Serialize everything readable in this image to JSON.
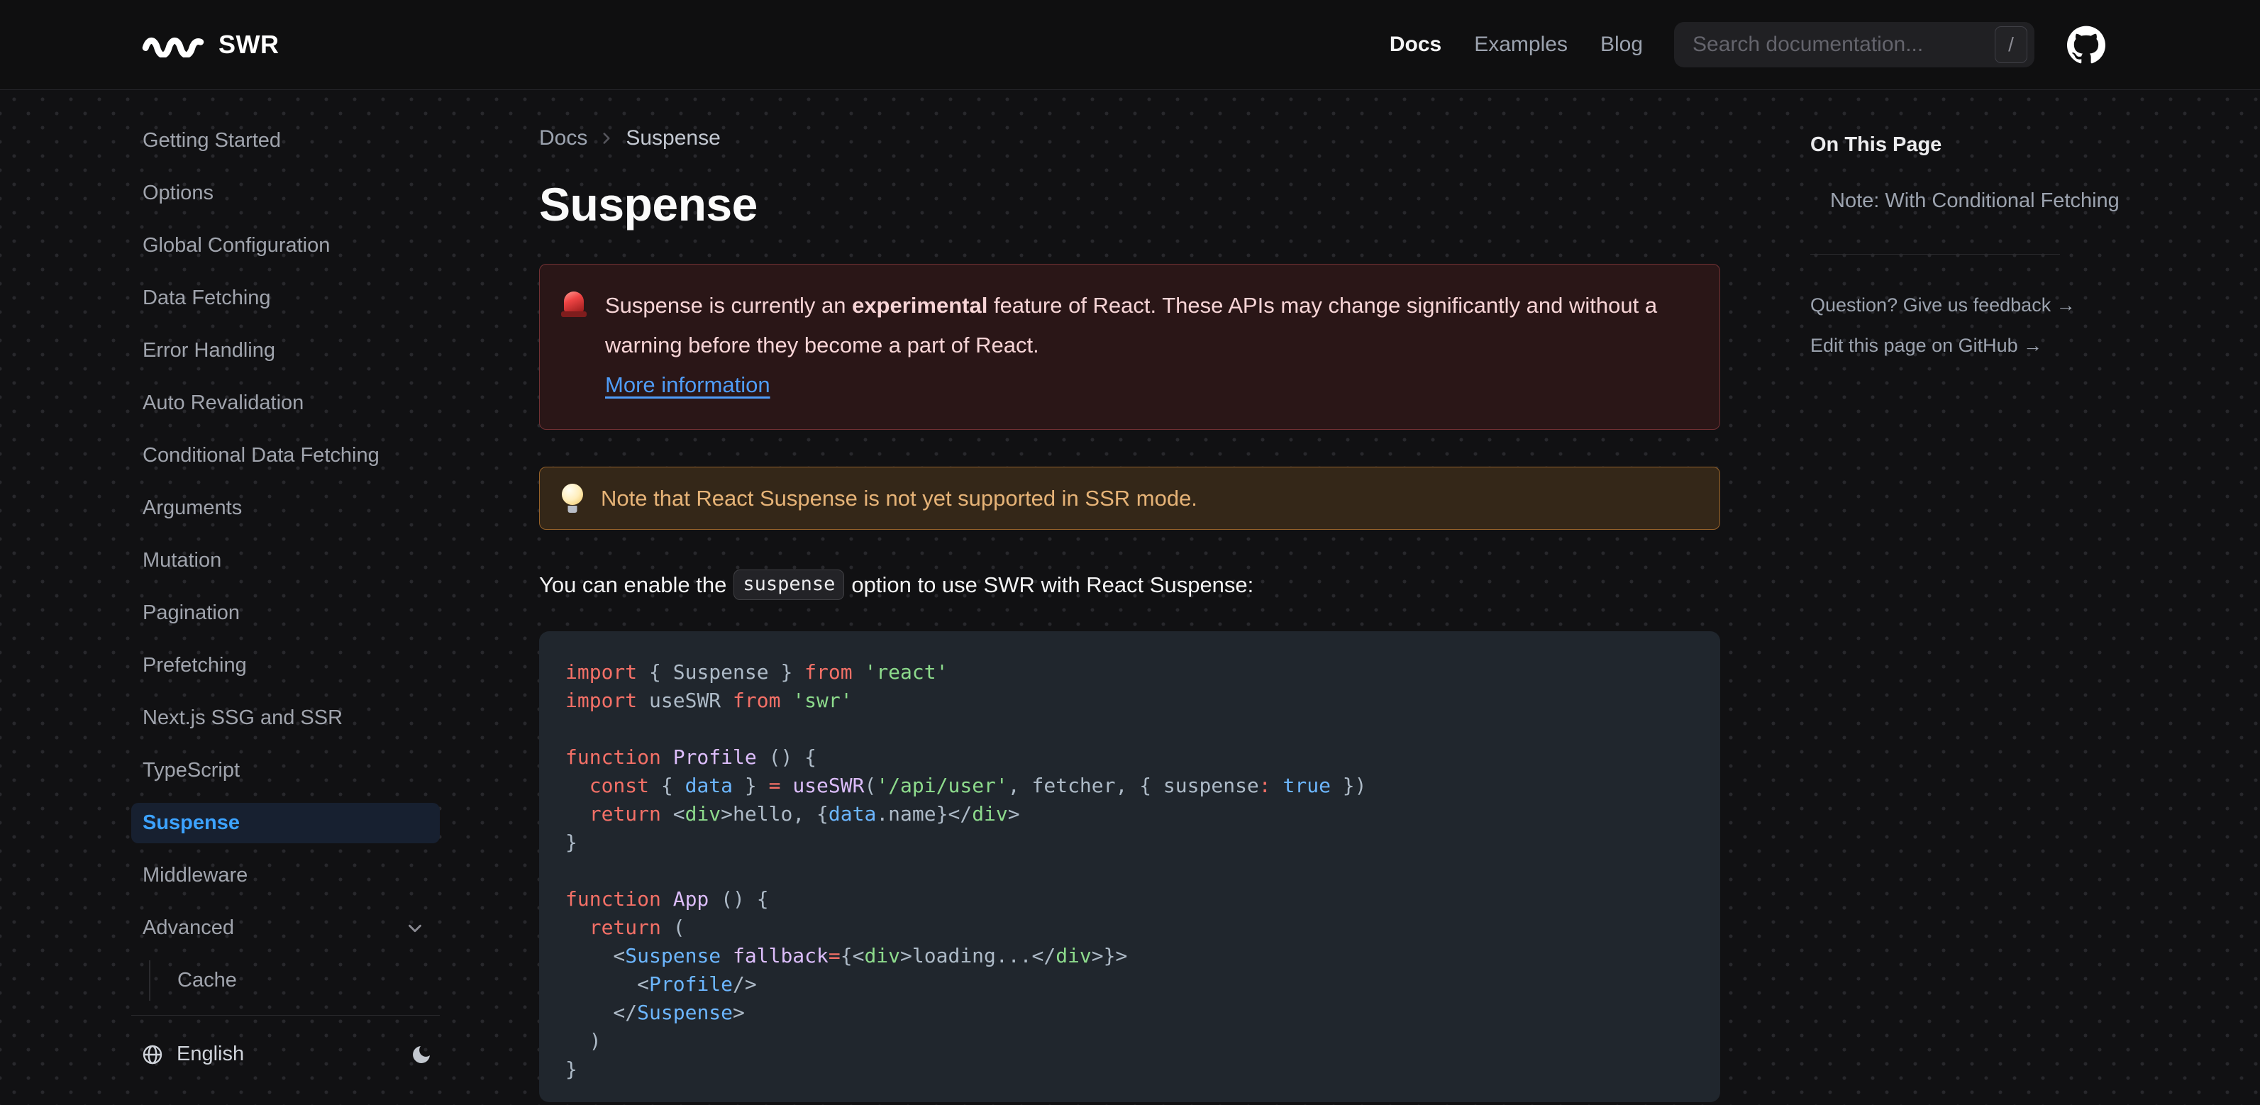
{
  "header": {
    "brand": "SWR",
    "nav": [
      {
        "label": "Docs",
        "active": true
      },
      {
        "label": "Examples",
        "active": false
      },
      {
        "label": "Blog",
        "active": false
      }
    ],
    "search": {
      "placeholder": "Search documentation...",
      "shortcut": "/"
    },
    "icons": {
      "logo": "swr-wave-icon",
      "github": "github-icon"
    }
  },
  "sidebar": {
    "items": [
      {
        "label": "Getting Started"
      },
      {
        "label": "Options"
      },
      {
        "label": "Global Configuration"
      },
      {
        "label": "Data Fetching"
      },
      {
        "label": "Error Handling"
      },
      {
        "label": "Auto Revalidation"
      },
      {
        "label": "Conditional Data Fetching"
      },
      {
        "label": "Arguments"
      },
      {
        "label": "Mutation"
      },
      {
        "label": "Pagination"
      },
      {
        "label": "Prefetching"
      },
      {
        "label": "Next.js SSG and SSR"
      },
      {
        "label": "TypeScript"
      },
      {
        "label": "Suspense",
        "active": true
      },
      {
        "label": "Middleware"
      },
      {
        "label": "Advanced",
        "expandable": true
      }
    ],
    "sub_items": [
      {
        "label": "Cache",
        "parent": "Advanced"
      }
    ],
    "language": "English",
    "icons": {
      "language": "globe-icon",
      "theme_toggle": "moon-icon",
      "advanced": "chevron-down-icon"
    }
  },
  "breadcrumb": {
    "items": [
      "Docs",
      "Suspense"
    ],
    "separator_icon": "chevron-right-icon"
  },
  "page": {
    "title": "Suspense",
    "warning_callout": {
      "icon": "police-light-icon",
      "text_before_bold": "Suspense is currently an ",
      "bold_text": "experimental",
      "text_after_bold": " feature of React. These APIs may change significantly and without a warning before they become a part of React.",
      "link_label": "More information"
    },
    "note_callout": {
      "icon": "light-bulb-icon",
      "text": "Note that React Suspense is not yet supported in SSR mode."
    },
    "paragraph": {
      "before_code": "You can enable the",
      "inline_code": "suspense",
      "after_code": "option to use SWR with React Suspense:"
    }
  },
  "code_block": {
    "language": "jsx",
    "lines": [
      [
        [
          "k",
          "import"
        ],
        [
          "p",
          " { Suspense } "
        ],
        [
          "k",
          "from"
        ],
        [
          "p",
          " "
        ],
        [
          "s",
          "'react'"
        ]
      ],
      [
        [
          "k",
          "import"
        ],
        [
          "p",
          " useSWR "
        ],
        [
          "k",
          "from"
        ],
        [
          "p",
          " "
        ],
        [
          "s",
          "'swr'"
        ]
      ],
      [],
      [
        [
          "k",
          "function"
        ],
        [
          "p",
          " "
        ],
        [
          "f",
          "Profile"
        ],
        [
          "p",
          " () {"
        ]
      ],
      [
        [
          "p",
          "  "
        ],
        [
          "k",
          "const"
        ],
        [
          "p",
          " { "
        ],
        [
          "v",
          "data"
        ],
        [
          "p",
          " } "
        ],
        [
          "k",
          "="
        ],
        [
          "p",
          " "
        ],
        [
          "f",
          "useSWR"
        ],
        [
          "p",
          "("
        ],
        [
          "s",
          "'/api/user'"
        ],
        [
          "p",
          ", fetcher, { suspense"
        ],
        [
          "k",
          ":"
        ],
        [
          "p",
          " "
        ],
        [
          "v",
          "true"
        ],
        [
          "p",
          " })"
        ]
      ],
      [
        [
          "p",
          "  "
        ],
        [
          "k",
          "return"
        ],
        [
          "p",
          " <"
        ],
        [
          "t",
          "div"
        ],
        [
          "p",
          ">hello, {"
        ],
        [
          "v",
          "data"
        ],
        [
          "p",
          ".name}</"
        ],
        [
          "t",
          "div"
        ],
        [
          "p",
          ">"
        ]
      ],
      [
        [
          "p",
          "}"
        ]
      ],
      [],
      [
        [
          "k",
          "function"
        ],
        [
          "p",
          " "
        ],
        [
          "f",
          "App"
        ],
        [
          "p",
          " () {"
        ]
      ],
      [
        [
          "p",
          "  "
        ],
        [
          "k",
          "return"
        ],
        [
          "p",
          " ("
        ]
      ],
      [
        [
          "p",
          "    <"
        ],
        [
          "v",
          "Suspense"
        ],
        [
          "p",
          " "
        ],
        [
          "f",
          "fallback"
        ],
        [
          "k",
          "="
        ],
        [
          "p",
          "{<"
        ],
        [
          "t",
          "div"
        ],
        [
          "p",
          ">loading...</"
        ],
        [
          "t",
          "div"
        ],
        [
          "p",
          ">}>"
        ]
      ],
      [
        [
          "p",
          "      <"
        ],
        [
          "v",
          "Profile"
        ],
        [
          "p",
          "/>"
        ]
      ],
      [
        [
          "p",
          "    </"
        ],
        [
          "v",
          "Suspense"
        ],
        [
          "p",
          ">"
        ]
      ],
      [
        [
          "p",
          "  )"
        ]
      ],
      [
        [
          "p",
          "}"
        ]
      ]
    ]
  },
  "toc": {
    "title": "On This Page",
    "items": [
      "Note: With Conditional Fetching"
    ],
    "links": [
      "Question? Give us feedback →",
      "Edit this page on GitHub →"
    ]
  },
  "colors": {
    "page-bg": "#111113",
    "header-border": "#26262a",
    "accent": "#3ca2ff",
    "sidebar-active-bg": "#172030",
    "error-bg": "#2a1617",
    "error-border": "#713134",
    "error-text": "#f7d4d6",
    "link-blue": "#4f9cf8",
    "note-bg": "#342718",
    "note-border": "#96622a",
    "note-text": "#e6b377",
    "code-bg": "#20262d",
    "tok-keyword": "#f47067",
    "tok-plain": "#adbac7",
    "tok-string": "#8ddb8c",
    "tok-func": "#dcbdfb",
    "tok-var": "#6cb6ff",
    "tok-tag": "#8ddb8c"
  }
}
